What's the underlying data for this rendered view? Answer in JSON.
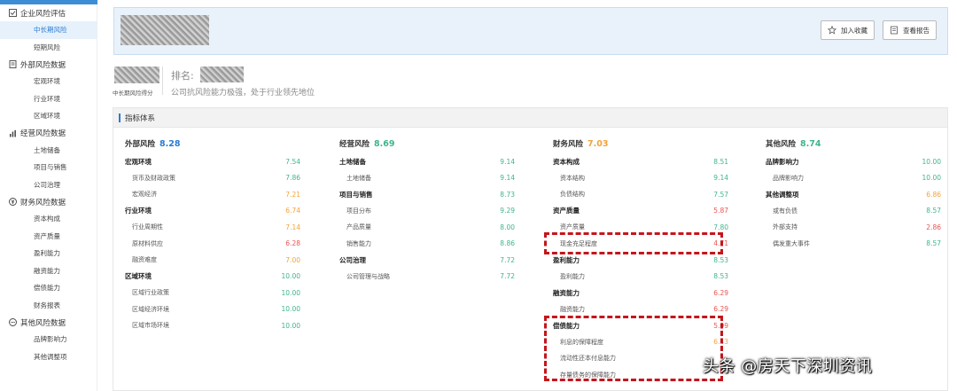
{
  "sidebar": {
    "groups": [
      {
        "label": "企业风险评估",
        "icon": "checkbox-icon",
        "items": [
          {
            "label": "中长期风险",
            "active": true
          },
          {
            "label": "短期风险"
          }
        ]
      },
      {
        "label": "外部风险数据",
        "icon": "document-icon",
        "items": [
          {
            "label": "宏观环境"
          },
          {
            "label": "行业环境"
          },
          {
            "label": "区域环境"
          }
        ]
      },
      {
        "label": "经营风险数据",
        "icon": "bar-chart-icon",
        "items": [
          {
            "label": "土地储备"
          },
          {
            "label": "项目与销售"
          },
          {
            "label": "公司治理"
          }
        ]
      },
      {
        "label": "财务风险数据",
        "icon": "money-icon",
        "items": [
          {
            "label": "资本构成"
          },
          {
            "label": "资产质量"
          },
          {
            "label": "盈利能力"
          },
          {
            "label": "融资能力"
          },
          {
            "label": "偿债能力"
          },
          {
            "label": "财务报表"
          }
        ]
      },
      {
        "label": "其他风险数据",
        "icon": "circle-dots-icon",
        "items": [
          {
            "label": "品牌影响力"
          },
          {
            "label": "其他调整项"
          }
        ]
      }
    ]
  },
  "header": {
    "favorite_label": "加入收藏",
    "report_label": "查看报告"
  },
  "score": {
    "score_label": "中长期风险得分",
    "rank_label": "排名:",
    "description": "公司抗风险能力极强，处于行业领先地位"
  },
  "panel": {
    "title": "指标体系"
  },
  "columns": [
    {
      "title": "外部风险",
      "score": "8.28",
      "score_color": "#2b7bd1",
      "rows": [
        {
          "label": "宏观环境",
          "type": "cat",
          "value": "7.54",
          "color": "green"
        },
        {
          "label": "货币及财政政策",
          "type": "sub",
          "value": "7.86",
          "color": "green"
        },
        {
          "label": "宏观经济",
          "type": "sub",
          "value": "7.21",
          "color": "orange"
        },
        {
          "label": "行业环境",
          "type": "cat",
          "value": "6.74",
          "color": "orange"
        },
        {
          "label": "行业周期性",
          "type": "sub",
          "value": "7.14",
          "color": "orange"
        },
        {
          "label": "原材料供应",
          "type": "sub",
          "value": "6.28",
          "color": "red"
        },
        {
          "label": "融资难度",
          "type": "sub",
          "value": "7.00",
          "color": "orange"
        },
        {
          "label": "区域环境",
          "type": "cat",
          "value": "10.00",
          "color": "green"
        },
        {
          "label": "区域行业政策",
          "type": "sub",
          "value": "10.00",
          "color": "green"
        },
        {
          "label": "区域经济环境",
          "type": "sub",
          "value": "10.00",
          "color": "green"
        },
        {
          "label": "区域市场环境",
          "type": "sub",
          "value": "10.00",
          "color": "green"
        }
      ]
    },
    {
      "title": "经营风险",
      "score": "8.69",
      "score_color": "#3fb48c",
      "rows": [
        {
          "label": "土地储备",
          "type": "cat",
          "value": "9.14",
          "color": "green"
        },
        {
          "label": "土地储备",
          "type": "sub",
          "value": "9.14",
          "color": "green"
        },
        {
          "label": "项目与销售",
          "type": "cat",
          "value": "8.73",
          "color": "green"
        },
        {
          "label": "项目分布",
          "type": "sub",
          "value": "9.29",
          "color": "green"
        },
        {
          "label": "产品质量",
          "type": "sub",
          "value": "8.00",
          "color": "green"
        },
        {
          "label": "销售能力",
          "type": "sub",
          "value": "8.86",
          "color": "green"
        },
        {
          "label": "公司治理",
          "type": "cat",
          "value": "7.72",
          "color": "green"
        },
        {
          "label": "公司管理与战略",
          "type": "sub",
          "value": "7.72",
          "color": "green"
        }
      ]
    },
    {
      "title": "财务风险",
      "score": "7.03",
      "score_color": "#f3a23a",
      "rows": [
        {
          "label": "资本构成",
          "type": "cat",
          "value": "8.51",
          "color": "green"
        },
        {
          "label": "资本结构",
          "type": "sub",
          "value": "9.14",
          "color": "green"
        },
        {
          "label": "负债结构",
          "type": "sub",
          "value": "7.57",
          "color": "green"
        },
        {
          "label": "资产质量",
          "type": "cat",
          "value": "5.87",
          "color": "red"
        },
        {
          "label": "资产质量",
          "type": "sub",
          "value": "7.80",
          "color": "green"
        },
        {
          "label": "现金充足程度",
          "type": "sub",
          "value": "4.71",
          "color": "red"
        },
        {
          "label": "盈利能力",
          "type": "cat",
          "value": "8.53",
          "color": "green"
        },
        {
          "label": "盈利能力",
          "type": "sub",
          "value": "8.53",
          "color": "green"
        },
        {
          "label": "融资能力",
          "type": "cat",
          "value": "6.29",
          "color": "red"
        },
        {
          "label": "融资能力",
          "type": "sub",
          "value": "6.29",
          "color": "red"
        },
        {
          "label": "偿债能力",
          "type": "cat",
          "value": "5.99",
          "color": "red"
        },
        {
          "label": "利息的保障程度",
          "type": "sub",
          "value": "6.43",
          "color": "orange"
        },
        {
          "label": "流动性还本付息能力",
          "type": "sub",
          "value": "",
          "color": "red"
        },
        {
          "label": "存量债务的保障能力",
          "type": "sub",
          "value": "",
          "color": "red"
        }
      ]
    },
    {
      "title": "其他风险",
      "score": "8.74",
      "score_color": "#3fb48c",
      "rows": [
        {
          "label": "品牌影响力",
          "type": "cat",
          "value": "10.00",
          "color": "green"
        },
        {
          "label": "品牌影响力",
          "type": "sub",
          "value": "10.00",
          "color": "green"
        },
        {
          "label": "其他调整项",
          "type": "cat",
          "value": "6.86",
          "color": "orange"
        },
        {
          "label": "或有负债",
          "type": "sub",
          "value": "8.57",
          "color": "green"
        },
        {
          "label": "外部支持",
          "type": "sub",
          "value": "2.86",
          "color": "red"
        },
        {
          "label": "偶发重大事件",
          "type": "sub",
          "value": "8.57",
          "color": "green"
        }
      ]
    }
  ],
  "watermark": "头条 @房天下深圳资讯"
}
